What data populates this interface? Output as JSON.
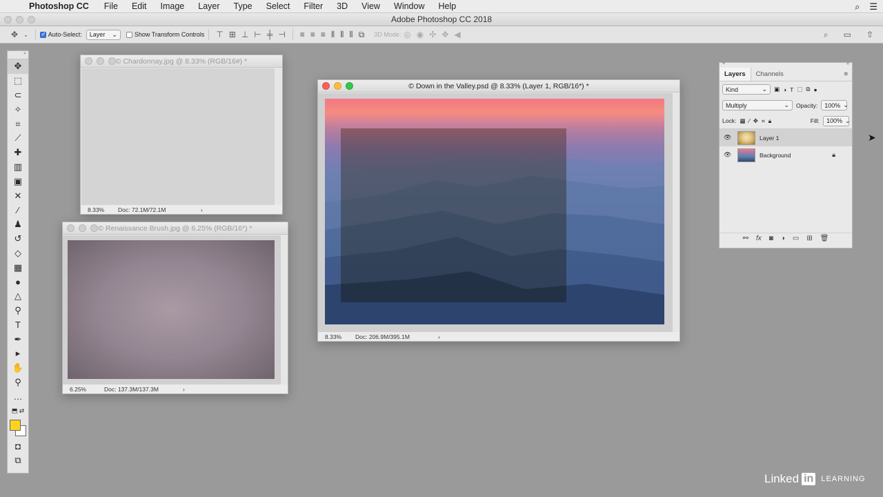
{
  "menubar": {
    "app_name": "Photoshop CC",
    "items": [
      "File",
      "Edit",
      "Image",
      "Layer",
      "Type",
      "Select",
      "Filter",
      "3D",
      "View",
      "Window",
      "Help"
    ]
  },
  "app_title": "Adobe Photoshop CC 2018",
  "options_bar": {
    "auto_select_label": "Auto-Select:",
    "auto_select_value": "Layer",
    "show_transform_label": "Show Transform Controls",
    "mode_3d_label": "3D Mode:"
  },
  "docs": {
    "chardonnay": {
      "title": "© Chardonnay.jpg @ 8.33% (RGB/16#) *",
      "zoom": "8.33%",
      "docinfo": "Doc: 72.1M/72.1M"
    },
    "renaissance": {
      "title": "© Renaissance  Brush.jpg @ 6.25% (RGB/16*) *",
      "zoom": "6.25%",
      "docinfo": "Doc: 137.3M/137.3M"
    },
    "valley": {
      "title": "© Down in the Valley.psd @ 8.33% (Layer 1, RGB/16*) *",
      "zoom": "8.33%",
      "docinfo": "Doc: 206.9M/395.1M"
    }
  },
  "layers_panel": {
    "tabs": [
      "Layers",
      "Channels"
    ],
    "kind_filter": "Kind",
    "blend_mode": "Multiply",
    "opacity_label": "Opacity:",
    "opacity_value": "100%",
    "lock_label": "Lock:",
    "fill_label": "Fill:",
    "fill_value": "100%",
    "layers": [
      {
        "name": "Layer 1",
        "selected": true,
        "visible": true
      },
      {
        "name": "Background",
        "selected": false,
        "visible": true,
        "locked": true
      }
    ]
  },
  "watermark": {
    "brand": "Linked",
    "in": "in",
    "suffix": "LEARNING"
  },
  "colors": {
    "foreground": "#ffd21f",
    "background": "#ffffff",
    "workspace": "#9a9a9a"
  }
}
